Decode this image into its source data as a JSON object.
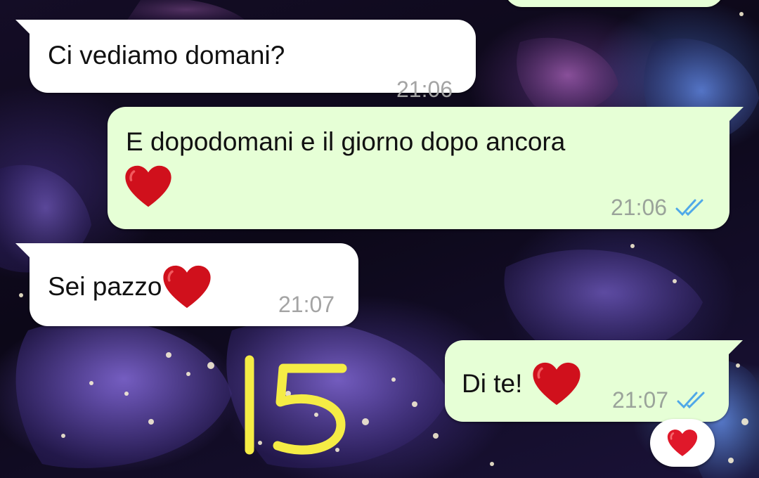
{
  "chat": {
    "messages": [
      {
        "direction": "outgoing",
        "text": "",
        "time": "",
        "partial": true
      },
      {
        "direction": "incoming",
        "text": "Ci vediamo domani?",
        "time": "21:06"
      },
      {
        "direction": "outgoing",
        "text": "E dopodomani e il giorno dopo ancora",
        "emoji": "red-heart",
        "time": "21:06",
        "status": "read"
      },
      {
        "direction": "incoming",
        "text": "Sei pazzo",
        "emoji": "red-heart",
        "time": "21:07"
      },
      {
        "direction": "outgoing",
        "text": "Di te!",
        "emoji": "red-heart",
        "time": "21:07",
        "status": "read"
      }
    ],
    "reaction": {
      "emoji": "red-heart",
      "on_message": 4
    }
  },
  "annotation": {
    "text": "15",
    "color": "#f5ec45"
  },
  "colors": {
    "incoming_bubble": "#ffffff",
    "outgoing_bubble": "#e6ffd6",
    "read_ticks": "#4fa8e8",
    "timestamp": "#9aa39a",
    "heart": "#d0101c"
  }
}
